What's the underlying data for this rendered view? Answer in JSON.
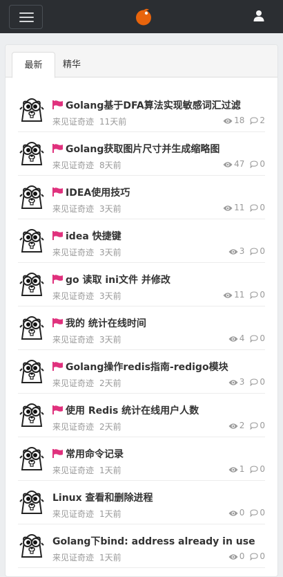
{
  "colors": {
    "navbar": "#2b2e32",
    "flag": "#e0317d",
    "logo": "#e8640c"
  },
  "navbar": {
    "menu_icon": "hamburger-icon",
    "logo_icon": "orange-logo-icon",
    "user_icon": "user-icon"
  },
  "tabs": [
    {
      "label": "最新",
      "active": true
    },
    {
      "label": "精华",
      "active": false
    }
  ],
  "topics": [
    {
      "title": "Golang基于DFA算法实现敏感词汇过滤",
      "author": "来见证奇迹",
      "time": "11天前",
      "views": "18",
      "comments": "2",
      "flag": true
    },
    {
      "title": "Golang获取图片尺寸并生成缩略图",
      "author": "来见证奇迹",
      "time": "8天前",
      "views": "47",
      "comments": "0",
      "flag": true
    },
    {
      "title": "IDEA使用技巧",
      "author": "来见证奇迹",
      "time": "3天前",
      "views": "11",
      "comments": "0",
      "flag": true
    },
    {
      "title": "idea 快捷键",
      "author": "来见证奇迹",
      "time": "3天前",
      "views": "3",
      "comments": "0",
      "flag": true
    },
    {
      "title": "go 读取 ini文件 并修改",
      "author": "来见证奇迹",
      "time": "3天前",
      "views": "11",
      "comments": "0",
      "flag": true
    },
    {
      "title": "我的 统计在线时间",
      "author": "来见证奇迹",
      "time": "3天前",
      "views": "4",
      "comments": "0",
      "flag": true
    },
    {
      "title": "Golang操作redis指南-redigo模块",
      "author": "来见证奇迹",
      "time": "2天前",
      "views": "3",
      "comments": "0",
      "flag": true
    },
    {
      "title": "使用 Redis 统计在线用户人数",
      "author": "来见证奇迹",
      "time": "2天前",
      "views": "2",
      "comments": "0",
      "flag": true
    },
    {
      "title": "常用命令记录",
      "author": "来见证奇迹",
      "time": "1天前",
      "views": "1",
      "comments": "0",
      "flag": true
    },
    {
      "title": "Linux 查看和删除进程",
      "author": "来见证奇迹",
      "time": "1天前",
      "views": "0",
      "comments": "0",
      "flag": false
    },
    {
      "title": "Golang下bind: address already in use",
      "author": "来见证奇迹",
      "time": "1天前",
      "views": "0",
      "comments": "0",
      "flag": false
    }
  ]
}
